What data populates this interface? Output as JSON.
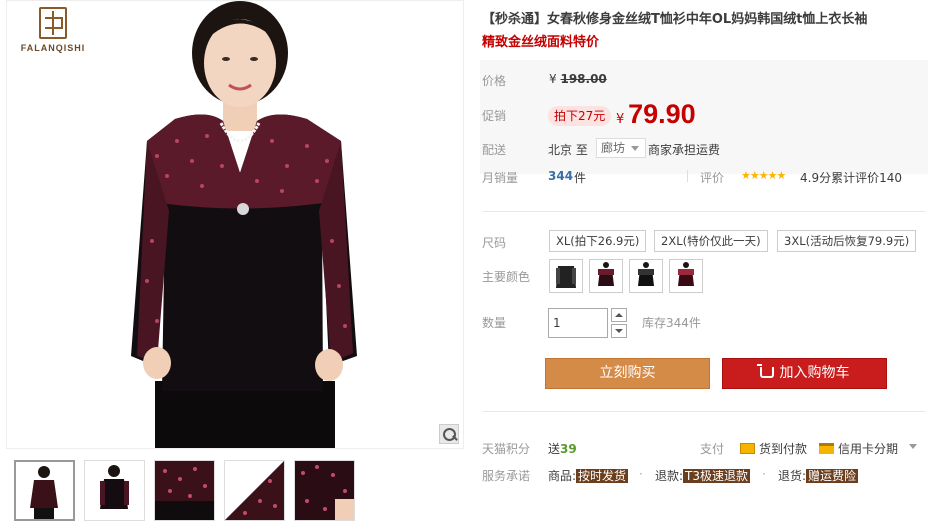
{
  "brand": {
    "name": "FALANQISHI"
  },
  "product": {
    "title": "【秒杀通】女春秋修身金丝绒T恤衫中年OL妈妈韩国绒t恤上衣长袖",
    "subtitle": "精致金丝绒面料特价"
  },
  "price": {
    "label": "价格",
    "currency": "¥",
    "original": "198.00"
  },
  "promo": {
    "label": "促销",
    "tag": "拍下27元",
    "currency": "¥",
    "price": "79.90"
  },
  "shipping": {
    "label": "配送",
    "from": "北京",
    "to_word": "至",
    "district": "廊坊",
    "fee": "商家承担运费"
  },
  "sales": {
    "label": "月销量",
    "count": "344",
    "unit": "件",
    "rating_label": "评价",
    "stars": "★★★★★",
    "rating_text": "4.9分累计评价140"
  },
  "size": {
    "label": "尺码",
    "options": [
      "XL(拍下26.9元)",
      "2XL(特价仅此一天)",
      "3XL(活动后恢复79.9元)"
    ]
  },
  "color": {
    "label": "主要颜色"
  },
  "quantity": {
    "label": "数量",
    "value": "1",
    "stock": "库存344件"
  },
  "actions": {
    "buy": "立刻购买",
    "cart": "加入购物车"
  },
  "points": {
    "label": "天猫积分",
    "prefix": "送",
    "value": "39"
  },
  "payment": {
    "label": "支付",
    "cod": "货到付款",
    "card": "信用卡分期"
  },
  "service": {
    "label": "服务承诺",
    "items": [
      {
        "prefix": "商品:",
        "badge": "按时发货"
      },
      {
        "prefix": "退款:",
        "badge": "T3极速退款"
      },
      {
        "prefix": "退货:",
        "badge": "赠运费险"
      }
    ]
  },
  "colors": {
    "accent_red": "#c40000",
    "buy_button": "#d58b48",
    "cart_button": "#c91c1c",
    "star": "#ffb400"
  }
}
